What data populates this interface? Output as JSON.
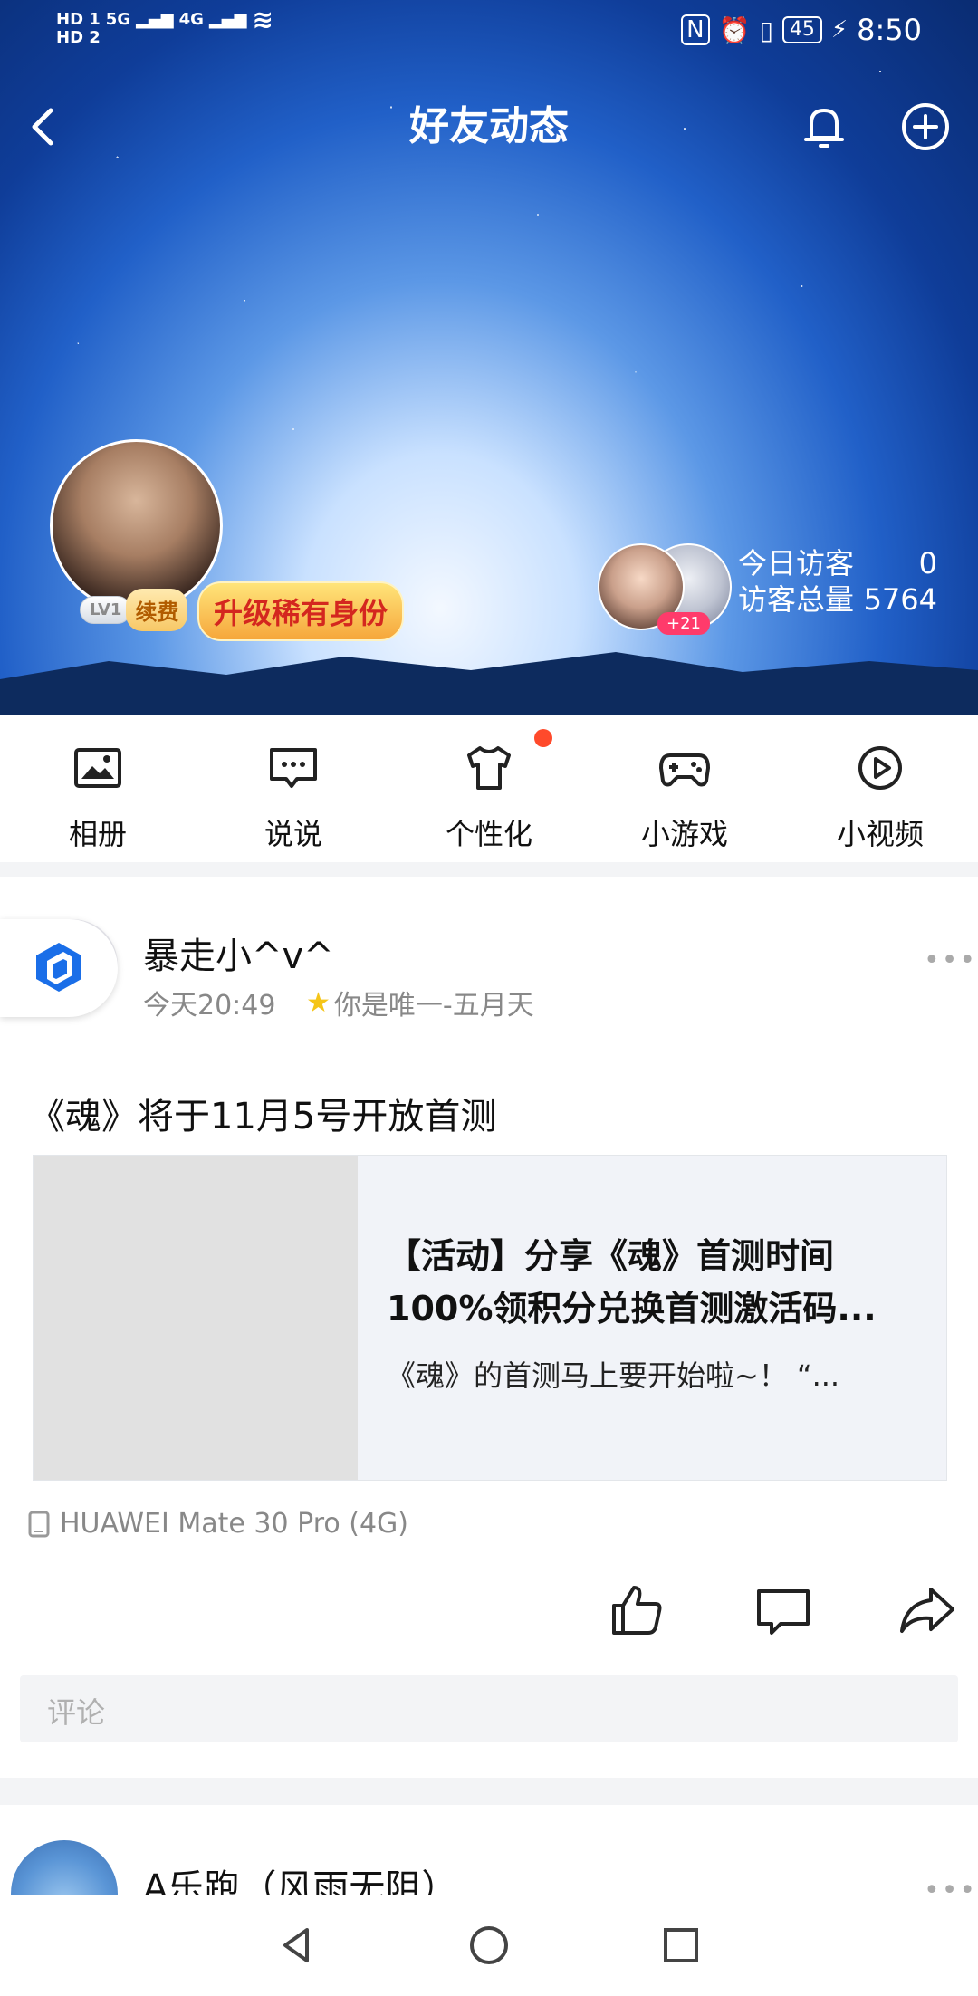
{
  "status_bar": {
    "sim1": "HD 1",
    "sim2": "HD 2",
    "net1": "5G",
    "net2": "4G",
    "battery": "45",
    "time": "8:50"
  },
  "header": {
    "title": "好友动态"
  },
  "profile": {
    "level": "LV1",
    "renew": "续费",
    "upgrade": "升级稀有身份",
    "visitor_more": "+21",
    "today_visitors_label": "今日访客",
    "today_visitors_value": "0",
    "total_visitors_label": "访客总量",
    "total_visitors_value": "5764"
  },
  "quick_nav": [
    {
      "label": "相册",
      "icon": "photo-album-icon"
    },
    {
      "label": "说说",
      "icon": "message-bubble-icon"
    },
    {
      "label": "个性化",
      "icon": "tshirt-icon"
    },
    {
      "label": "小游戏",
      "icon": "gamepad-icon"
    },
    {
      "label": "小视频",
      "icon": "play-video-icon"
    }
  ],
  "post": {
    "author": "暴走小^v^",
    "time": "今天20:49",
    "mood": "你是唯一-五月天",
    "text": "《魂》将于11月5号开放首测",
    "card": {
      "title": "【活动】分享《魂》首测时间100%领积分兑换首测激活码...",
      "desc": "《魂》的首测马上要开始啦~！ “..."
    },
    "device": "HUAWEI Mate 30 Pro (4G)",
    "comment_placeholder": "评论"
  },
  "next_post": {
    "author": "A乐跑（风雨无阻）"
  },
  "colors": {
    "accent_red": "#ff4a2b",
    "upgrade_text": "#d4271f"
  }
}
